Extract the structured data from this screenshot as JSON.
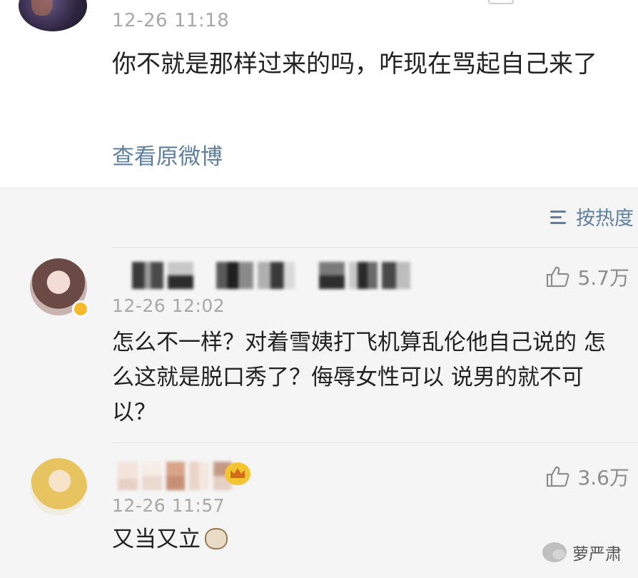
{
  "top_comment": {
    "timestamp": "12-26 11:18",
    "text": "你不就是那样过来的吗，咋现在骂起自己来了",
    "view_original_label": "查看原微博"
  },
  "sort": {
    "icon": "sort-lines-icon",
    "label": "按热度"
  },
  "comments": [
    {
      "username_blurred": "████ ███ ████",
      "verified_badge_color": "#f5b82e",
      "timestamp": "12-26 12:02",
      "likes": "5.7万",
      "text": "怎么不一样？对着雪姨打飞机算乱伦他自己说的 怎么这就是脱口秀了？侮辱女性可以 说男的就不可以？"
    },
    {
      "username_blurred": "██ █ ██",
      "crown_badge_color": "#f3c531",
      "timestamp": "12-26 11:57",
      "likes": "3.6万",
      "text": "又当又立",
      "emoji": "cat-face-emoji"
    }
  ],
  "watermark": {
    "icon": "wechat-icon",
    "label": "萝严肃"
  },
  "colors": {
    "link": "#5f7f9e",
    "timestamp": "#a8a8a8",
    "background_gray": "#f5f5f5"
  }
}
